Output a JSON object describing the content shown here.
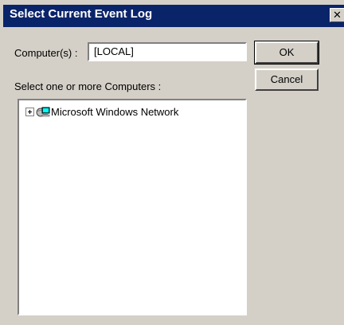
{
  "dialog": {
    "title": "Select Current Event Log",
    "close_symbol": "✕"
  },
  "computer": {
    "label": "Computer(s) :",
    "value": "[LOCAL]"
  },
  "buttons": {
    "ok_label": "OK",
    "cancel_label": "Cancel"
  },
  "tree": {
    "heading": "Select one or more Computers :",
    "items": [
      {
        "label": "Microsoft Windows Network",
        "icon": "network-globe-icon",
        "expander": "plus"
      }
    ]
  },
  "colors": {
    "titlebar": "#0a246a",
    "face": "#d4d0c8",
    "field_bg": "#ffffff"
  }
}
